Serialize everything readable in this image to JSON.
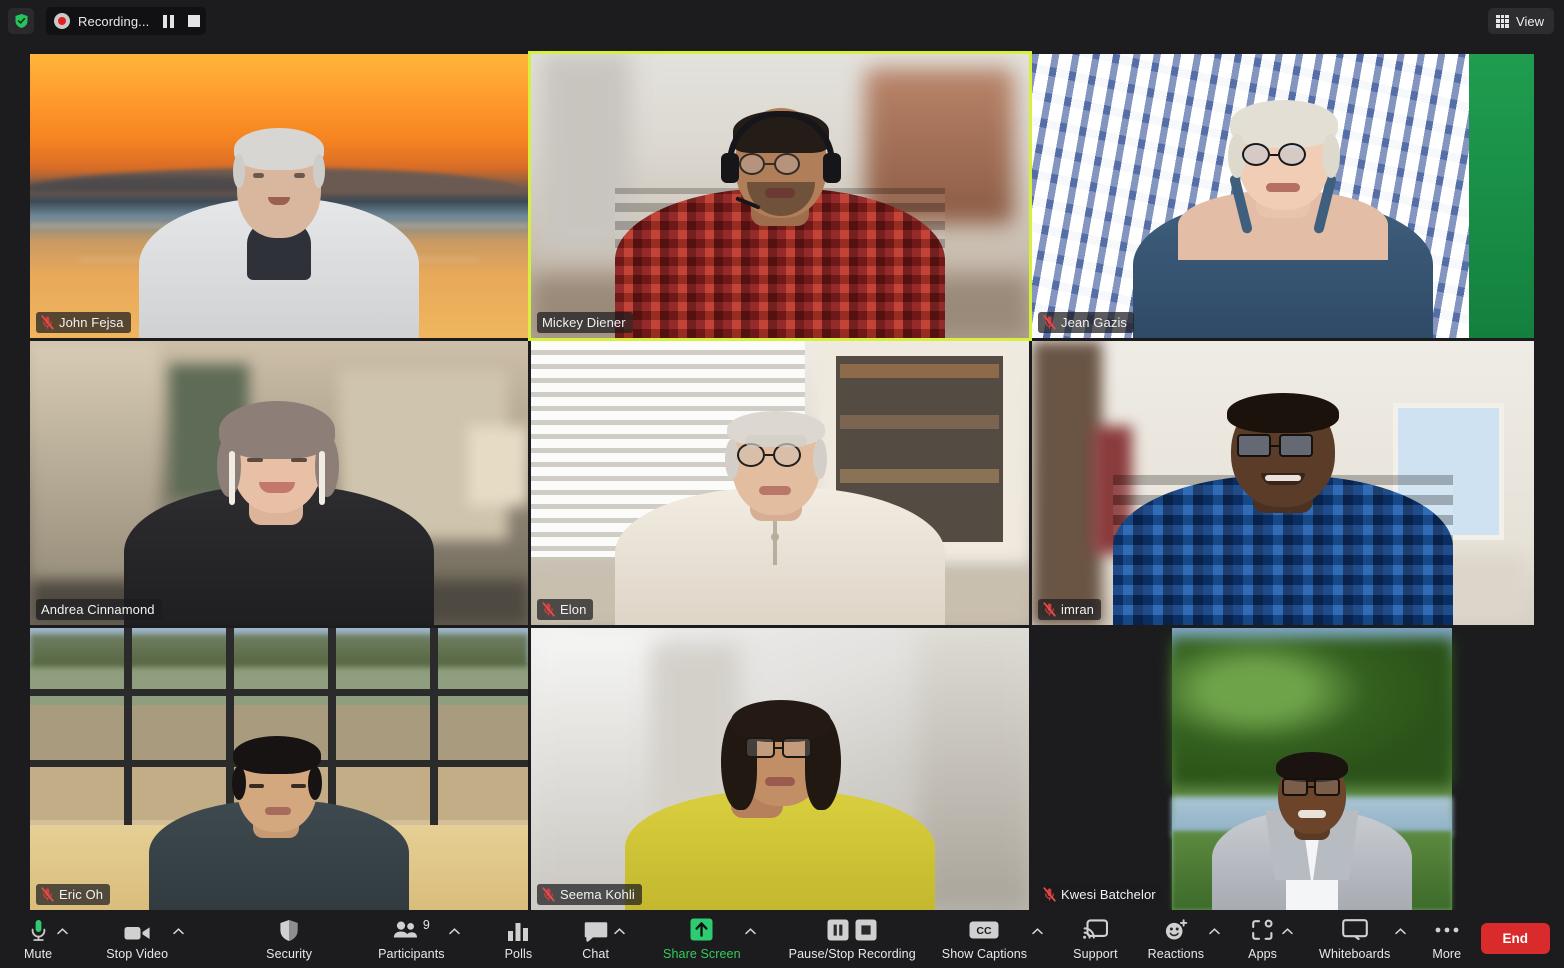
{
  "window": {
    "title": "Zoom Meeting",
    "accent_green": "#32cd5b",
    "active_speaker_border": "#d6f03c",
    "end_button_color": "#d92b2b"
  },
  "topbar": {
    "security_shield_icon": "shield-check-icon",
    "recording": {
      "label": "Recording...",
      "record_icon": "record-dot-icon",
      "pause_icon": "pause-icon",
      "stop_icon": "stop-icon"
    },
    "view": {
      "label": "View",
      "icon": "grid-view-icon"
    }
  },
  "grid": {
    "layout": "gallery",
    "rows": 3,
    "columns": 3,
    "participants": [
      {
        "name": "John Fejsa",
        "muted": true,
        "active_speaker": false,
        "video_on": true,
        "background": "sunset-lake-virtual-background"
      },
      {
        "name": "Mickey Diener",
        "muted": false,
        "active_speaker": true,
        "video_on": true,
        "background": "blurred-room"
      },
      {
        "name": "Jean Gazis",
        "muted": true,
        "active_speaker": false,
        "video_on": true,
        "background": "blue-white-patterned-curtain"
      },
      {
        "name": "Andrea Cinnamond",
        "muted": false,
        "active_speaker": false,
        "video_on": true,
        "background": "home-hallway"
      },
      {
        "name": "Elon",
        "muted": true,
        "active_speaker": false,
        "video_on": true,
        "background": "bookshelf-and-blinds"
      },
      {
        "name": "imran",
        "muted": true,
        "active_speaker": false,
        "video_on": true,
        "background": "home-office"
      },
      {
        "name": "Eric Oh",
        "muted": true,
        "active_speaker": false,
        "video_on": true,
        "background": "desert-window-view"
      },
      {
        "name": "Seema Kohli",
        "muted": true,
        "active_speaker": false,
        "video_on": true,
        "background": "blurred-interior"
      },
      {
        "name": "Kwesi Batchelor",
        "muted": true,
        "active_speaker": false,
        "video_on": true,
        "background": "riverside-trees"
      }
    ]
  },
  "toolbar": {
    "items": [
      {
        "label": "Mute",
        "icon": "microphone-icon",
        "caret": true,
        "green": false
      },
      {
        "label": "Stop Video",
        "icon": "video-camera-icon",
        "caret": true,
        "green": false
      },
      {
        "label": "Security",
        "icon": "shield-icon",
        "caret": false,
        "green": false
      },
      {
        "label": "Participants",
        "icon": "participants-icon",
        "caret": true,
        "green": false,
        "badge": "9"
      },
      {
        "label": "Polls",
        "icon": "polls-bars-icon",
        "caret": false,
        "green": false
      },
      {
        "label": "Chat",
        "icon": "chat-bubble-icon",
        "caret": true,
        "green": false
      },
      {
        "label": "Share Screen",
        "icon": "share-screen-up-arrow-icon",
        "caret": true,
        "green": true
      },
      {
        "label": "Pause/Stop Recording",
        "icon": "pause-stop-recording-icon",
        "caret": false,
        "green": false
      },
      {
        "label": "Show Captions",
        "icon": "closed-captions-icon",
        "caret": true,
        "green": false
      },
      {
        "label": "Support",
        "icon": "support-screencast-icon",
        "caret": false,
        "green": false
      },
      {
        "label": "Reactions",
        "icon": "reactions-smiley-icon",
        "caret": true,
        "green": false
      },
      {
        "label": "Apps",
        "icon": "apps-icon",
        "caret": true,
        "green": false
      },
      {
        "label": "Whiteboards",
        "icon": "whiteboard-icon",
        "caret": true,
        "green": false
      },
      {
        "label": "More",
        "icon": "more-ellipsis-icon",
        "caret": false,
        "green": false
      }
    ],
    "end_label": "End"
  }
}
